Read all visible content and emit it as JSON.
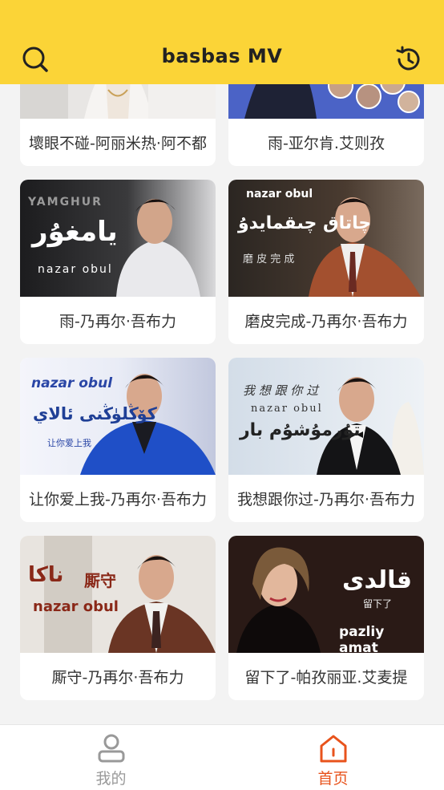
{
  "header": {
    "title": "basbas  MV",
    "search_icon": "search-icon",
    "history_icon": "history-icon",
    "background": "#fbd437"
  },
  "videos": [
    {
      "caption": "壞眼不碰-阿丽米热·阿不都",
      "thumb_text": []
    },
    {
      "caption": "雨-亚尔肯.艾则孜",
      "thumb_text": []
    },
    {
      "caption": "雨-乃再尔·吾布力",
      "thumb_text": [
        "YAMGHUR",
        "يامغۇر",
        "nazar obul"
      ]
    },
    {
      "caption": "磨皮完成-乃再尔·吾布力",
      "thumb_text": [
        "nazar obul",
        "چاتاق چىقمايدۇ",
        "磨 皮 完 成"
      ]
    },
    {
      "caption": "让你爱上我-乃再尔·吾布力",
      "thumb_text": [
        "nazar obul",
        "كۆڭلۈڭنى ئالاي",
        "让你爱上我"
      ]
    },
    {
      "caption": "我想跟你过-乃再尔·吾布力",
      "thumb_text": [
        "我 想 跟 你 过",
        "nazar obul",
        "تۇرمۇشۇم بار"
      ]
    },
    {
      "caption": "厮守-乃再尔·吾布力",
      "thumb_text": [
        "ناكا",
        "厮守",
        "nazar obul"
      ]
    },
    {
      "caption": "留下了-帕孜丽亚.艾麦提",
      "thumb_text": [
        "قالدى",
        "留下了",
        "pazliy amat"
      ]
    }
  ],
  "tabbar": {
    "items": [
      {
        "label": "我的",
        "icon": "user-icon",
        "active": false
      },
      {
        "label": "首页",
        "icon": "home-icon",
        "active": true
      }
    ],
    "active_color": "#e8531c",
    "inactive_color": "#999999"
  }
}
